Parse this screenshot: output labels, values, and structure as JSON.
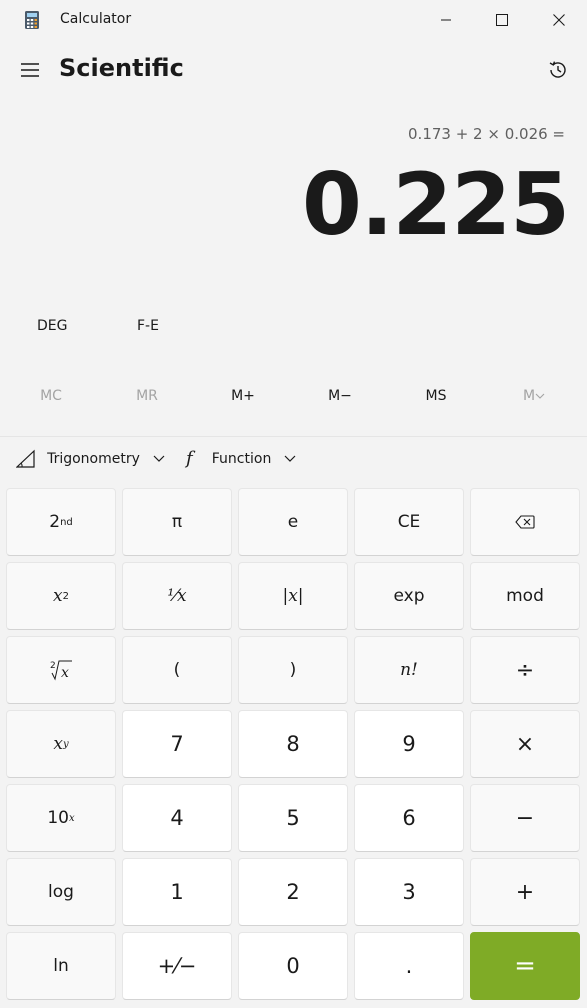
{
  "window": {
    "title": "Calculator"
  },
  "header": {
    "mode_title": "Scientific"
  },
  "display": {
    "expression": "0.173 + 2 × 0.026 =",
    "result": "0.225"
  },
  "modes": {
    "angle": "DEG",
    "notation": "F-E"
  },
  "memory": [
    "MC",
    "MR",
    "M+",
    "M−",
    "MS",
    "M"
  ],
  "functions": {
    "trigonometry": "Trigonometry",
    "function": "Function"
  },
  "keys": {
    "second": {
      "base": "2",
      "sup": "nd"
    },
    "pi": "π",
    "e": "e",
    "ce": "CE",
    "reciprocal": "¹⁄x",
    "abs": "|x|",
    "exp": "exp",
    "mod": "mod",
    "open_paren": "(",
    "close_paren": ")",
    "factorial": "n!",
    "divide": "÷",
    "seven": "7",
    "eight": "8",
    "nine": "9",
    "multiply": "×",
    "ten_power": {
      "base": "10",
      "sup": "x"
    },
    "four": "4",
    "five": "5",
    "six": "6",
    "minus": "−",
    "log": "log",
    "one": "1",
    "two": "2",
    "three": "3",
    "plus": "+",
    "ln": "ln",
    "negate": "+⁄−",
    "zero": "0",
    "decimal": ".",
    "equals": "="
  },
  "colors": {
    "background": "#f3f3f3",
    "equals_accent": "#7fab26",
    "number_key": "#ffffff",
    "function_key": "#f9f9f9"
  }
}
